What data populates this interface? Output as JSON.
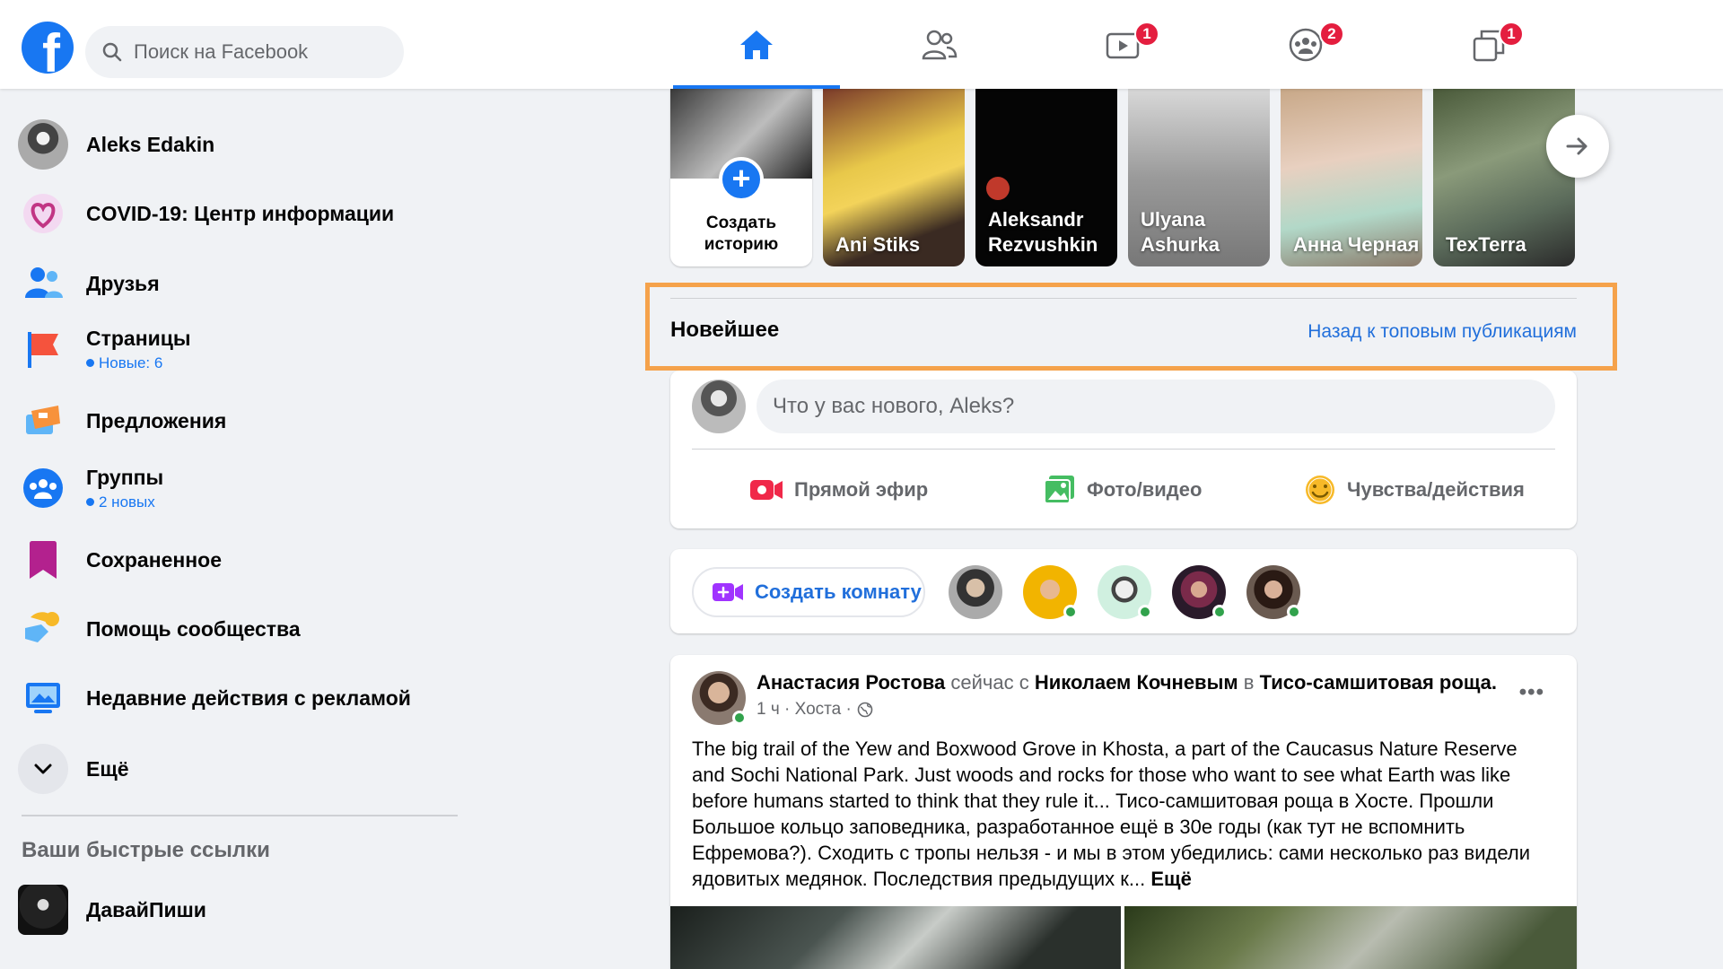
{
  "search": {
    "placeholder": "Поиск на Facebook"
  },
  "nav": {
    "tabs": [
      {
        "name": "home",
        "badge": ""
      },
      {
        "name": "friends",
        "badge": ""
      },
      {
        "name": "watch",
        "badge": "1"
      },
      {
        "name": "groups",
        "badge": "2"
      },
      {
        "name": "gaming",
        "badge": "1"
      }
    ]
  },
  "sidebar": {
    "items": [
      {
        "label": "Aleks Edakin",
        "sub": "",
        "icon": "profile-avatar"
      },
      {
        "label": "COVID-19: Центр информации",
        "sub": "",
        "icon": "covid-heart-icon"
      },
      {
        "label": "Друзья",
        "sub": "",
        "icon": "friends-icon"
      },
      {
        "label": "Страницы",
        "sub": "Новые: 6",
        "icon": "flag-icon"
      },
      {
        "label": "Предложения",
        "sub": "",
        "icon": "offers-icon"
      },
      {
        "label": "Группы",
        "sub": "2 новых",
        "icon": "groups-icon"
      },
      {
        "label": "Сохраненное",
        "sub": "",
        "icon": "bookmark-icon"
      },
      {
        "label": "Помощь сообщества",
        "sub": "",
        "icon": "community-help-icon"
      },
      {
        "label": "Недавние действия с рекламой",
        "sub": "",
        "icon": "ad-activity-icon"
      },
      {
        "label": "Ещё",
        "sub": "",
        "icon": "chevron-down-icon"
      }
    ],
    "shortcuts_title": "Ваши быстрые ссылки",
    "shortcuts": [
      {
        "label": "ДавайПиши"
      }
    ]
  },
  "stories": {
    "create_label": "Создать историю",
    "items": [
      {
        "name": "Ani Stiks"
      },
      {
        "name": "Aleksandr Rezvushkin"
      },
      {
        "name": "Ulyana Ashurka"
      },
      {
        "name": "Анна Черная"
      },
      {
        "name": "TexTerra"
      }
    ]
  },
  "feed_header": {
    "title": "Новейшее",
    "link": "Назад к топовым публикациям"
  },
  "composer": {
    "placeholder": "Что у вас нового, Aleks?",
    "actions": [
      "Прямой эфир",
      "Фото/видео",
      "Чувства/действия"
    ]
  },
  "rooms": {
    "button": "Создать комнату"
  },
  "post": {
    "author": "Анастасия Ростова",
    "when": "сейчас с",
    "with": "Николаем Кочневым",
    "in_word": "в",
    "place": "Тисо-самшитовая роща.",
    "meta": "1 ч · Хоста ·",
    "text": "The big trail of the Yew and Boxwood Grove in Khosta, a part of the Caucasus Nature Reserve and Sochi National Park. Just woods and rocks for those who want to see what Earth was like before humans started to think that they rule it... Тисо-самшитовая роща в Хосте. Прошли Большое кольцо заповедника, разработанное ещё в 30е годы (как тут не вспомнить Ефремова?). Сходить с тропы нельзя - и мы в этом убедились: сами несколько раз видели ядовитых медянок. Последствия предыдущих к...",
    "more": "Ещё"
  },
  "colors": {
    "brand": "#1877f2",
    "highlight": "#f5a24b",
    "badge": "#e41e3f"
  }
}
